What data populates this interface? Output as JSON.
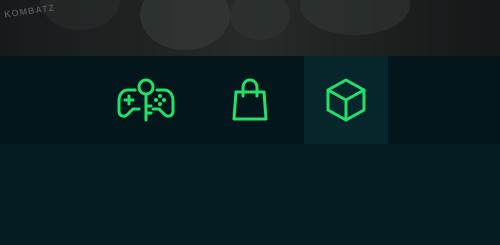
{
  "hero": {
    "overlay_text": "KOMBATZ"
  },
  "nav": {
    "items": [
      {
        "id": "games",
        "icon": "gamepad-key-icon",
        "active": false
      },
      {
        "id": "shop",
        "icon": "shopping-bag-icon",
        "active": false
      },
      {
        "id": "products",
        "icon": "cube-icon",
        "active": true
      }
    ]
  },
  "colors": {
    "accent": "#22e06a",
    "nav_background": "#02161b",
    "nav_active_background": "#07262c",
    "page_background": "#041c22"
  }
}
